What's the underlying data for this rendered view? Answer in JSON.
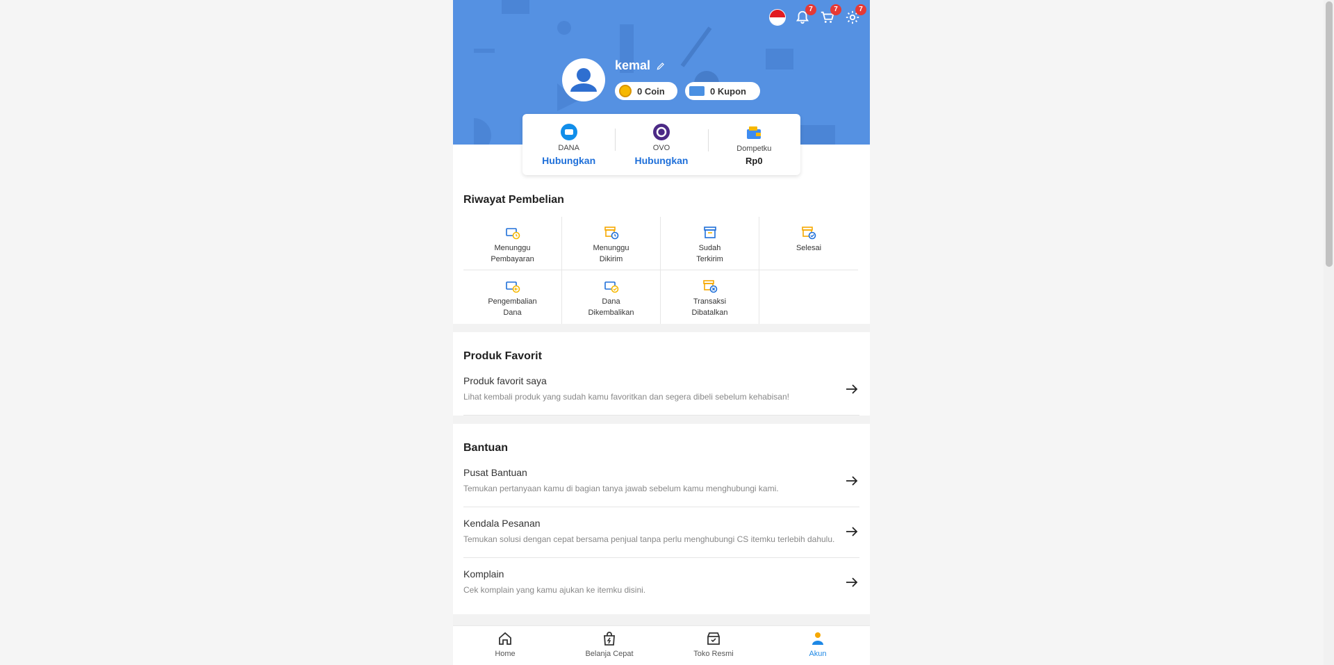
{
  "header": {
    "badges": {
      "notifications": "7",
      "cart": "7",
      "settings": "7"
    },
    "icons": [
      "indonesia-flag-icon",
      "bell-icon",
      "cart-icon",
      "gear-icon"
    ]
  },
  "profile": {
    "username": "kemal",
    "coin_label": "0 Coin",
    "kupon_label": "0 Kupon"
  },
  "wallets": [
    {
      "label": "DANA",
      "action": "Hubungkan",
      "icon": "dana-icon"
    },
    {
      "label": "OVO",
      "action": "Hubungkan",
      "icon": "ovo-icon"
    },
    {
      "label": "Dompetku",
      "value": "Rp0",
      "icon": "wallet-icon"
    }
  ],
  "riwayat": {
    "title": "Riwayat Pembelian",
    "items": [
      {
        "label": "Menunggu\nPembayaran",
        "icon": "payment-pending-icon"
      },
      {
        "label": "Menunggu\nDikirim",
        "icon": "shipping-pending-icon"
      },
      {
        "label": "Sudah\nTerkirim",
        "icon": "sent-box-icon"
      },
      {
        "label": "Selesai",
        "icon": "done-box-icon"
      },
      {
        "label": "Pengembalian\nDana",
        "icon": "refund-icon"
      },
      {
        "label": "Dana\nDikembalikan",
        "icon": "refunded-icon"
      },
      {
        "label": "Transaksi\nDibatalkan",
        "icon": "cancelled-icon"
      }
    ]
  },
  "favorit": {
    "title": "Produk Favorit",
    "row_title": "Produk favorit saya",
    "row_desc": "Lihat kembali produk yang sudah kamu favoritkan dan segera dibeli sebelum kehabisan!"
  },
  "bantuan": {
    "title": "Bantuan",
    "rows": [
      {
        "title": "Pusat Bantuan",
        "desc": "Temukan pertanyaan kamu di bagian tanya jawab sebelum kamu menghubungi kami."
      },
      {
        "title": "Kendala Pesanan",
        "desc": "Temukan solusi dengan cepat bersama penjual tanpa perlu menghubungi CS itemku terlebih dahulu."
      },
      {
        "title": "Komplain",
        "desc": "Cek komplain yang kamu ajukan ke itemku disini."
      }
    ]
  },
  "nav": {
    "home": "Home",
    "belanja": "Belanja Cepat",
    "toko": "Toko Resmi",
    "akun": "Akun"
  },
  "colors": {
    "hero": "#5591e2",
    "accent": "#1e6fd9",
    "active_nav": "#1e88e5",
    "badge": "#e53935"
  }
}
